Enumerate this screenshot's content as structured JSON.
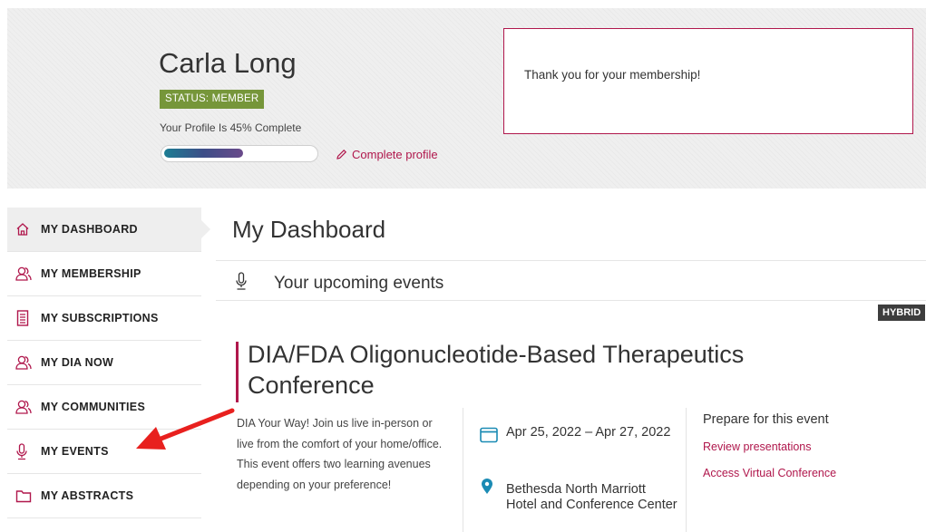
{
  "profile": {
    "name": "Carla Long",
    "status": "STATUS: MEMBER",
    "completion_text": "Your Profile Is 45% Complete",
    "completion_fraction": 0.45,
    "complete_link": "Complete profile"
  },
  "notice": {
    "message": "Thank you for your membership!"
  },
  "sidebar": {
    "items": [
      {
        "label": "MY DASHBOARD",
        "icon": "home-icon",
        "active": true
      },
      {
        "label": "MY MEMBERSHIP",
        "icon": "people-icon"
      },
      {
        "label": "MY SUBSCRIPTIONS",
        "icon": "document-icon"
      },
      {
        "label": "MY DIA NOW",
        "icon": "people-icon"
      },
      {
        "label": "MY COMMUNITIES",
        "icon": "people-icon"
      },
      {
        "label": "MY EVENTS",
        "icon": "microphone-icon"
      },
      {
        "label": "MY ABSTRACTS",
        "icon": "folder-icon"
      }
    ]
  },
  "main": {
    "title": "My Dashboard",
    "section": {
      "title": "Your upcoming events",
      "icon": "microphone-icon"
    },
    "event": {
      "badge": "HYBRID",
      "title_line1": "DIA/FDA Oligonucleotide-Based Therapeutics",
      "title_line2": "Conference",
      "description": "DIA Your Way! Join us live in-person or live from the comfort of your home/office. This event offers two learning avenues depending on your preference!",
      "date": "Apr 25, 2022 – Apr 27, 2022",
      "location": "Bethesda North Marriott Hotel and Conference Center",
      "prepare_heading": "Prepare for this event",
      "links": [
        "Review presentations",
        "Access Virtual Conference"
      ]
    }
  },
  "colors": {
    "accent": "#b0174c",
    "status_green": "#76963a",
    "annotation_arrow": "#e8201e"
  }
}
